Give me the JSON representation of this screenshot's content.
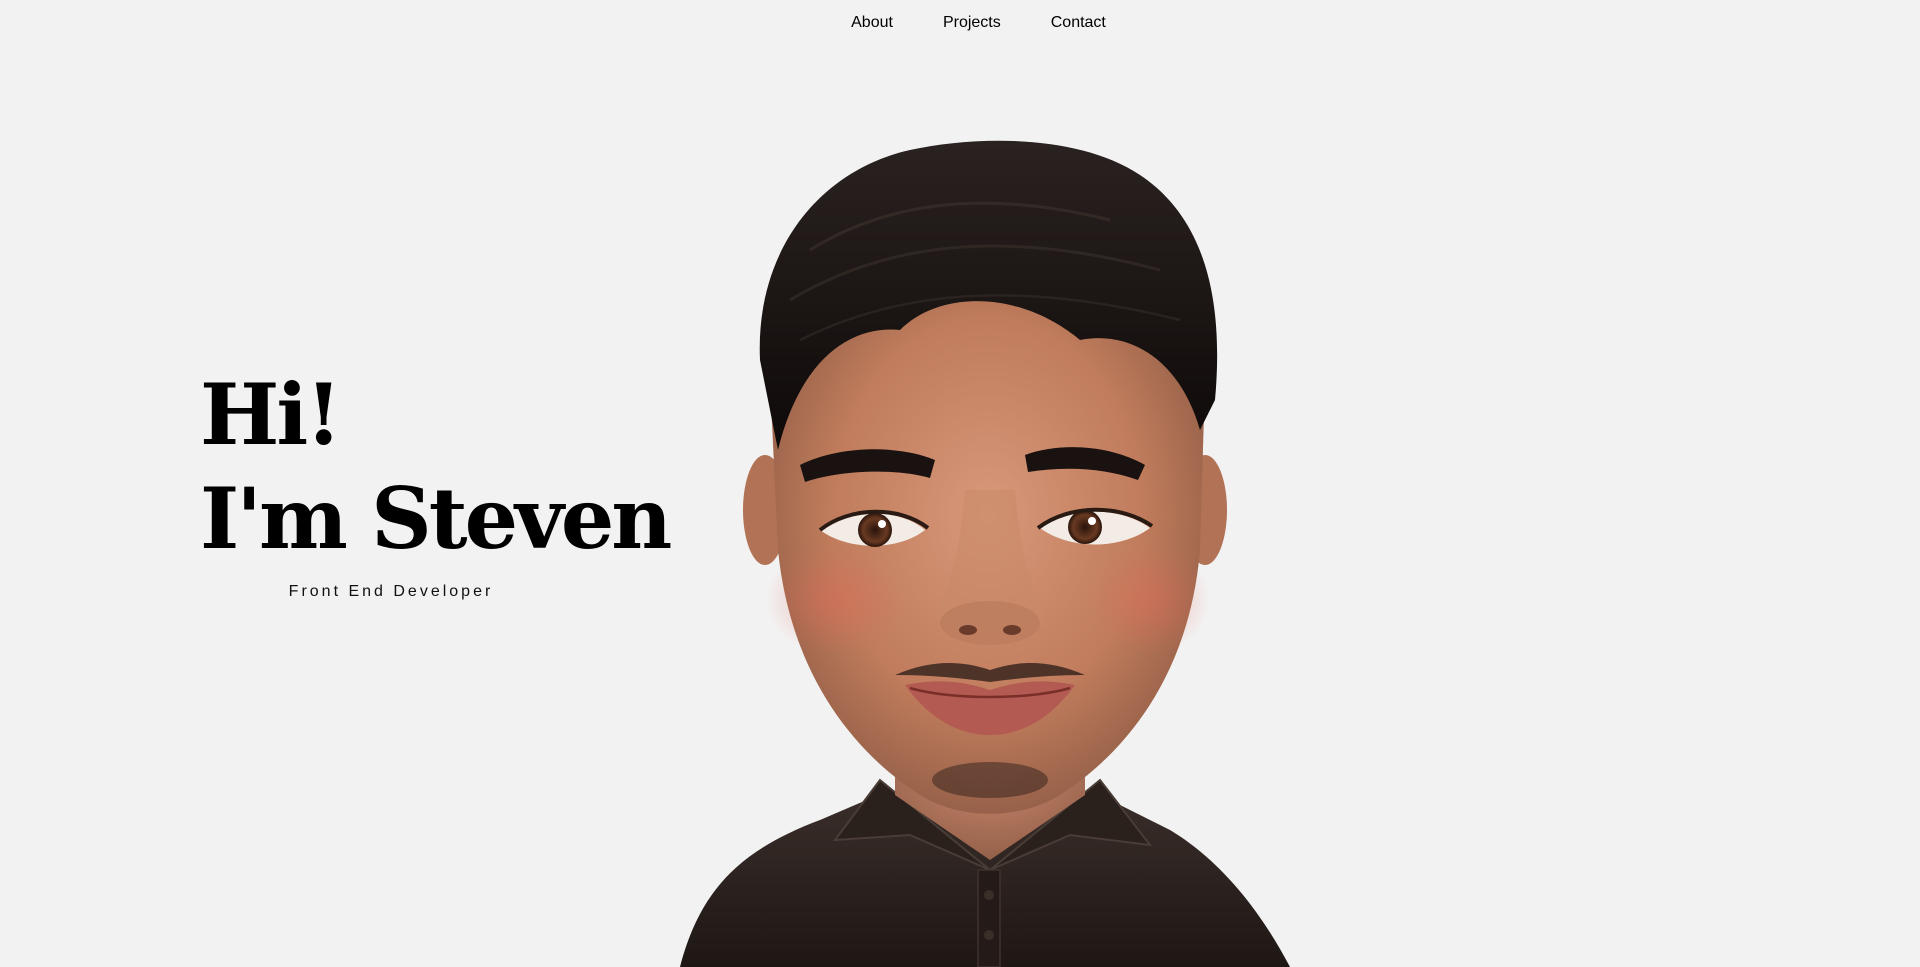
{
  "nav": {
    "items": [
      {
        "label": "About"
      },
      {
        "label": "Projects"
      },
      {
        "label": "Contact"
      }
    ]
  },
  "hero": {
    "greeting": "Hi!",
    "intro": "I'm Steven",
    "role": "Front End Developer"
  },
  "colors": {
    "background": "#f2f2f2",
    "text": "#000000",
    "skin": "#c98a68",
    "hair": "#1a1412",
    "shirt": "#2a201c"
  },
  "avatar": {
    "icon": "cartoon-portrait"
  }
}
